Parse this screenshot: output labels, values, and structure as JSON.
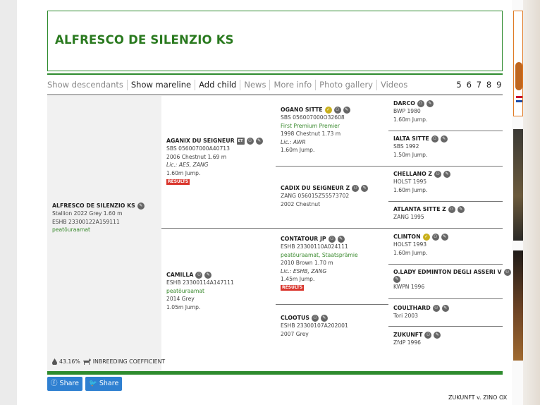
{
  "title": "ALFRESCO DE SILENZIO KS",
  "tabs": [
    "Show descendants",
    "Show mareline",
    "Add child",
    "News",
    "More info",
    "Photo gallery",
    "Videos"
  ],
  "pages": "5 6 7 8 9",
  "subject": {
    "name": "ALFRESCO DE SILENZIO KS",
    "line1": "Stallion 2022 Grey 1.60 m",
    "line2": "ESHB 23300122A159111",
    "line3": "peatõuraamat"
  },
  "sire": {
    "name": "AGANIX DU SEIGNEUR",
    "badge": "ET",
    "line1": "SBS 056007000A40713",
    "line2": "2006 Chestnut 1.69 m",
    "line3": "Lic.: AES, ZANG",
    "line4": "1.60m Jump.",
    "results": "RESULTS"
  },
  "dam": {
    "name": "CAMILLA",
    "line1": "ESHB 23300114A147111",
    "line2": "peatõuraamat",
    "line3": "2014 Grey",
    "line4": "1.05m Jump."
  },
  "gen3": [
    {
      "name": "OGANO SITTE",
      "line1": "SBS 056007000O32608",
      "line2": "First Premium Premier",
      "line3": "1998 Chestnut 1.73 m",
      "line4": "Lic.: AWR",
      "line5": "1.60m Jump."
    },
    {
      "name": "CADIX DU SEIGNEUR Z",
      "line1": "ZANG 056015Z55573702",
      "line2": "2002 Chestnut"
    },
    {
      "name": "CONTATOUR JP",
      "line1": "ESHB 23300110A024111",
      "line2": "peatõuraamat, Staatsprämie",
      "line3": "2010 Brown 1.70 m",
      "line4": "Lic.: ESHB, ZANG",
      "line5": "1.45m Jump.",
      "results": "RESULTS"
    },
    {
      "name": "CLOOTUS",
      "line1": "ESHB 23300107A202001",
      "line2": "2007 Grey"
    }
  ],
  "gen4": [
    {
      "name": "DARCO",
      "line1": "BWP 1980",
      "line2": "1.60m Jump."
    },
    {
      "name": "IALTA SITTE",
      "line1": "SBS 1992",
      "line2": "1.50m Jump."
    },
    {
      "name": "CHELLANO Z",
      "line1": "HOLST 1995",
      "line2": "1.60m Jump."
    },
    {
      "name": "ATLANTA SITTE Z",
      "line1": "ZANG 1995"
    },
    {
      "name": "CLINTON",
      "line1": "HOLST 1993",
      "line2": "1.60m Jump."
    },
    {
      "name": "O.LADY EDMINTON DEGLI ASSERI V",
      "line1": "KWPN 1996"
    },
    {
      "name": "COULTHARD",
      "line1": "Tori 2003"
    },
    {
      "name": "ZUKUNFT",
      "line1": "ZfdP 1996"
    }
  ],
  "inbreeding": {
    "value": "43.16%",
    "label": "INBREEDING COEFFICIENT"
  },
  "share": {
    "facebook": "Share",
    "twitter": "Share"
  },
  "footer": "ZUKUNFT v. ZINO OX",
  "colors": {
    "brand_green": "#2e8b2e",
    "title_green": "#2a7a1f",
    "results_red": "#d9342b",
    "share_blue": "#2f80d1",
    "gold_badge": "#c9b01c"
  },
  "icons": [
    "family-tree-icon",
    "pencil-icon",
    "gold-star-icon",
    "drop-icon",
    "horse-icon",
    "facebook-icon",
    "twitter-icon"
  ]
}
